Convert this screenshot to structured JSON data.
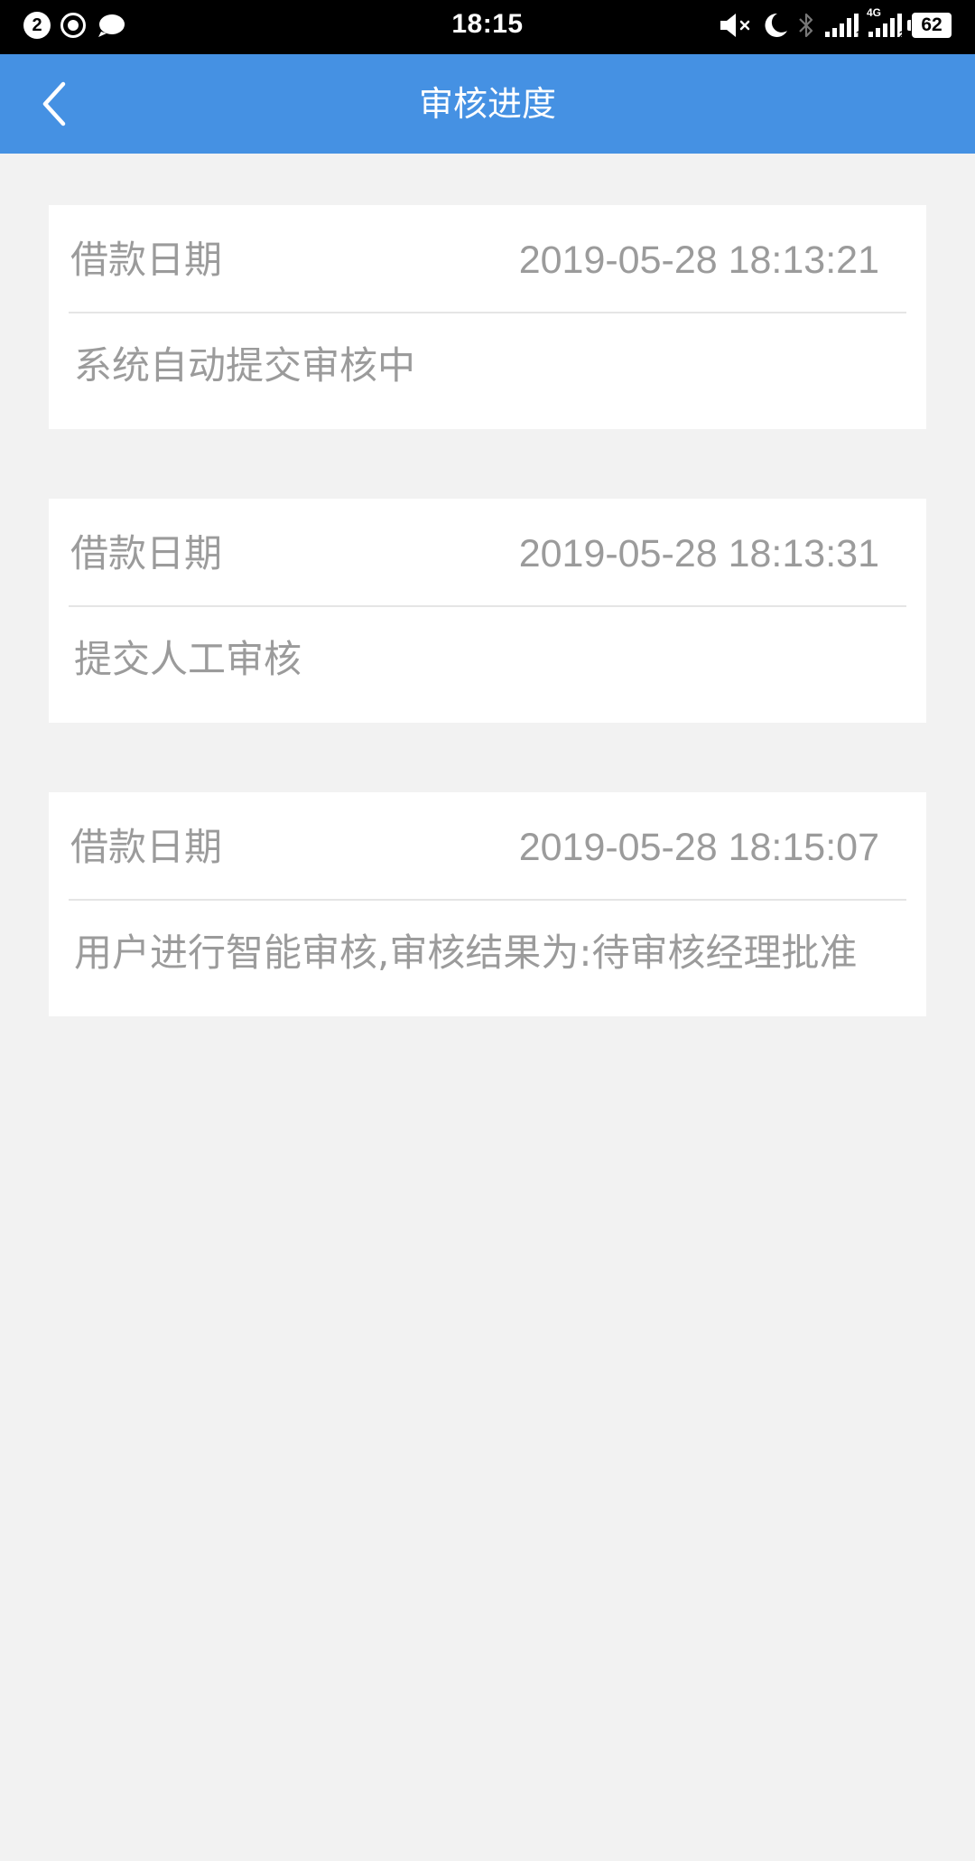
{
  "status_bar": {
    "notification_count": "2",
    "time": "18:15",
    "network_type": "4G",
    "sim_slot_1": "1",
    "sim_slot_2": "2",
    "battery_level": "62",
    "icons": [
      "notification-count-icon",
      "record-icon",
      "chat-icon",
      "mute-icon",
      "moon-icon",
      "bluetooth-icon",
      "signal-icon",
      "signal-4g-icon",
      "battery-icon"
    ]
  },
  "nav": {
    "title": "审核进度",
    "back_icon": "chevron-left-icon"
  },
  "records": [
    {
      "label": "借款日期",
      "datetime": "2019-05-28 18:13:21",
      "description": "系统自动提交审核中"
    },
    {
      "label": "借款日期",
      "datetime": "2019-05-28 18:13:31",
      "description": "提交人工审核"
    },
    {
      "label": "借款日期",
      "datetime": "2019-05-28 18:15:07",
      "description": "用户进行智能审核,审核结果为:待审核经理批准"
    }
  ],
  "colors": {
    "nav_background": "#4591e3",
    "page_background": "#f2f2f2",
    "card_background": "#ffffff",
    "text_gray": "#9b9b9b"
  }
}
